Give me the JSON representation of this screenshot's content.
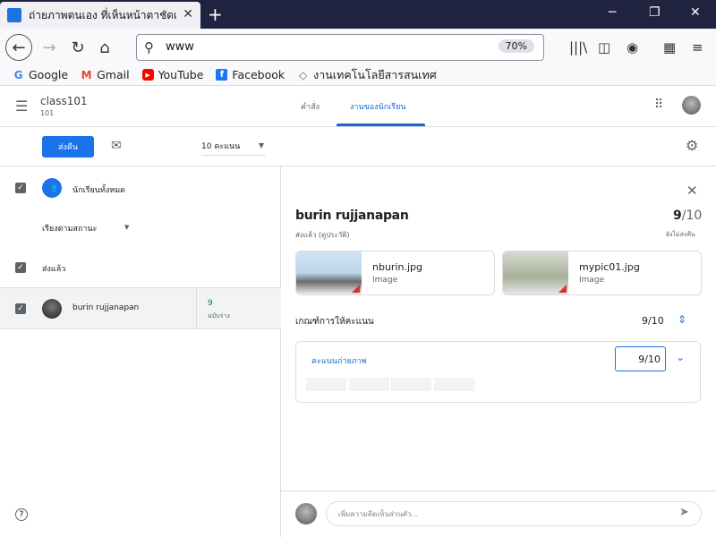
{
  "browser": {
    "tab_title": "ถ่ายภาพตนเอง ที่เห็นหน้าตาชัดเจ",
    "url": "www",
    "zoom": "70%",
    "bookmarks": [
      "Google",
      "Gmail",
      "YouTube",
      "Facebook",
      "งานเทคโนโลยีสารสนเทศ"
    ]
  },
  "app": {
    "class_name": "class101",
    "class_sub": "101",
    "tabs": [
      "คำสั่ง",
      "งานของนักเรียน"
    ]
  },
  "toolbar": {
    "return_label": "ส่งคืน",
    "points": "10 คะแนน"
  },
  "left": {
    "all_students": "นักเรียนทั้งหมด",
    "sort": "เรียงตามสถานะ",
    "section": "ส่งแล้ว",
    "student_name": "burin rujjanapan",
    "student_score": "9",
    "student_score_sub": "ฉบับร่าง"
  },
  "right": {
    "student_name": "burin rujjanapan",
    "status": "ส่งแล้ว (ดูประวัติ)",
    "score_num": "9",
    "score_den": "/10",
    "not_returned": "ยังไม่ส่งคืน",
    "attachments": [
      {
        "name": "nburin.jpg",
        "type": "Image"
      },
      {
        "name": "mypic01.jpg",
        "type": "Image"
      }
    ],
    "rubric_title": "เกณฑ์การให้คะแนน",
    "rubric_score": "9/10",
    "criterion_name": "คะแนนถ่ายภาพ",
    "criterion_score": "9/10",
    "comment_placeholder": "เพิ่มความคิดเห็นส่วนตัว..."
  }
}
